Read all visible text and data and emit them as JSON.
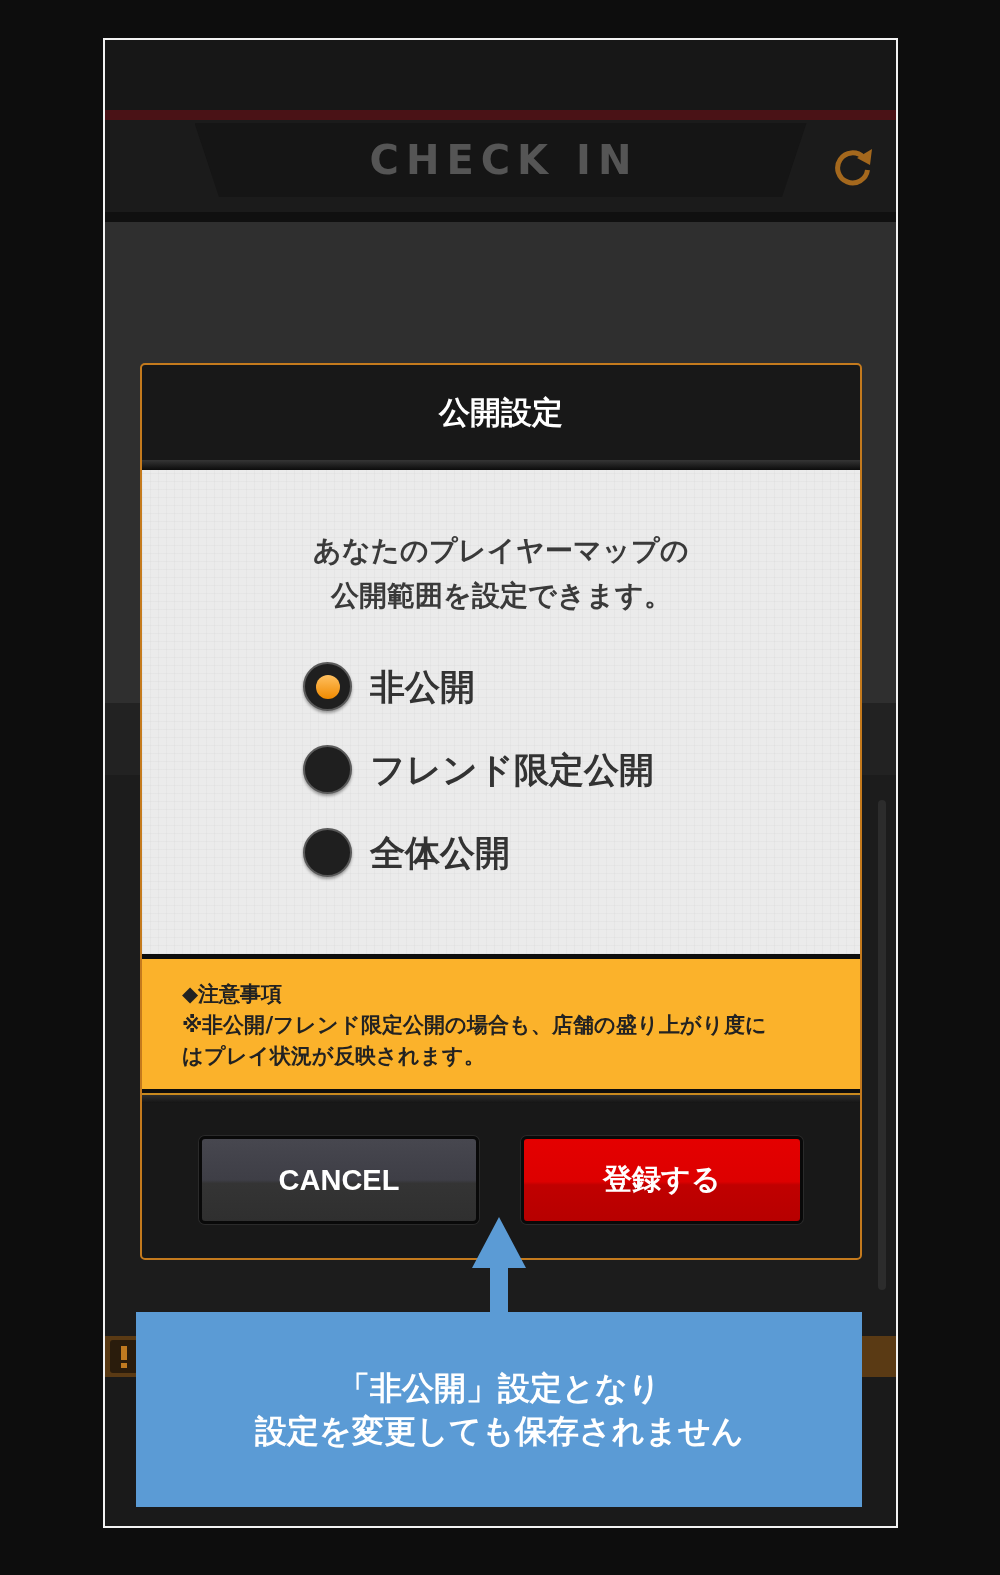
{
  "app_header": {
    "title": "CHECK IN"
  },
  "dialog": {
    "title": "公開設定",
    "message": "あなたのプレイヤーマップの公開範囲を設定できます。",
    "options": [
      {
        "label": "非公開",
        "selected": true
      },
      {
        "label": "フレンド限定公開",
        "selected": false
      },
      {
        "label": "全体公開",
        "selected": false
      }
    ],
    "notice": {
      "heading": "◆注意事項",
      "text": "※非公開/フレンド限定公開の場合も、店舗の盛り上がり度にはプレイ状況が反映されます。"
    },
    "buttons": [
      {
        "label": "CANCEL",
        "kind": "cancel"
      },
      {
        "label": "登録する",
        "kind": "primary"
      }
    ]
  },
  "callout": {
    "lines": [
      "「非公開」設定となり",
      "設定を変更しても保存されません"
    ]
  }
}
